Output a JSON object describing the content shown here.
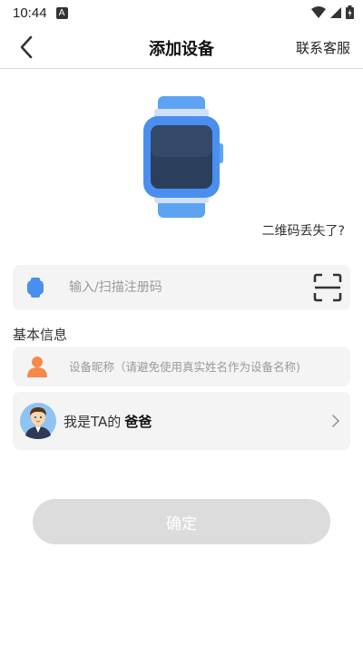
{
  "status_bar": {
    "time": "10:44",
    "notification_badge": "A"
  },
  "header": {
    "title": "添加设备",
    "service_link": "联系客服"
  },
  "qr_lost_link": "二维码丢失了?",
  "registration": {
    "placeholder": "输入/扫描注册码",
    "value": ""
  },
  "section_title": "基本信息",
  "nickname": {
    "placeholder": "设备昵称（请避免使用真实姓名作为设备名称)",
    "value": ""
  },
  "relation": {
    "prefix": "我是TA的",
    "value": "爸爸"
  },
  "confirm_button": "确定",
  "colors": {
    "accent_blue": "#4a8ff0",
    "person_orange": "#f5894a",
    "disabled_button": "#dcdcdc",
    "card_background": "#f4f4f4"
  }
}
